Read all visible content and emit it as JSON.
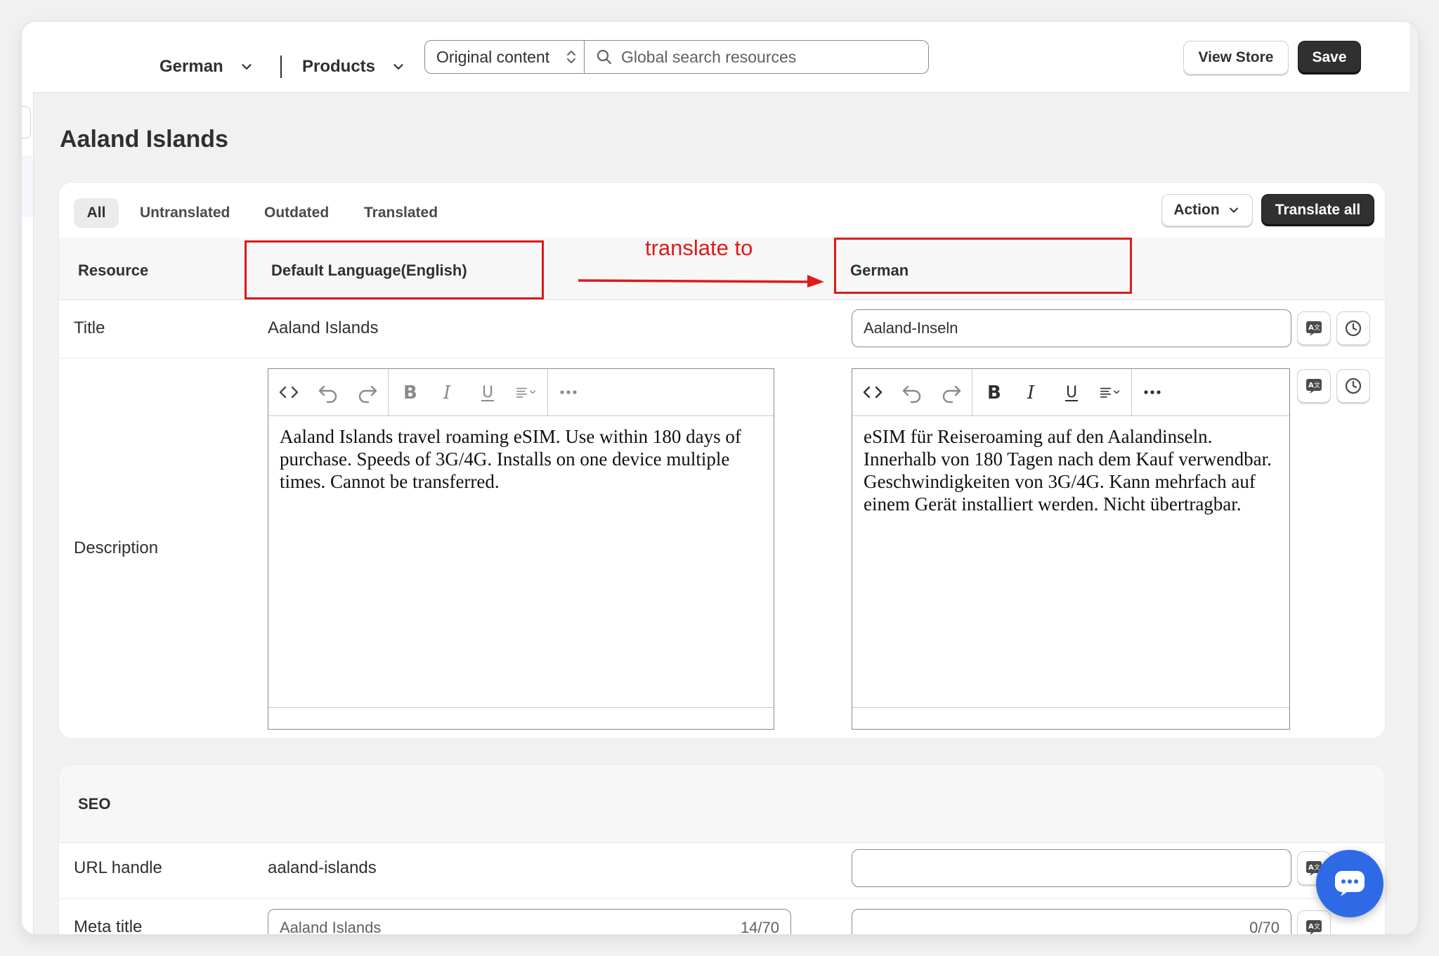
{
  "topbar": {
    "language": "German",
    "resource_type": "Products",
    "content_select": "Original content",
    "search_placeholder": "Global search resources",
    "view_store": "View Store",
    "save": "Save"
  },
  "page_title": "Aaland Islands",
  "tabs": [
    "All",
    "Untranslated",
    "Outdated",
    "Translated"
  ],
  "actions": {
    "action": "Action",
    "translate_all": "Translate all"
  },
  "columns": {
    "resource": "Resource",
    "default_language": "Default Language(English)",
    "target_language": "German"
  },
  "annotation": {
    "text": "translate to",
    "color": "#e01919"
  },
  "rows": {
    "title": {
      "label": "Title",
      "original": "Aaland Islands",
      "translated": "Aaland-Inseln"
    },
    "description": {
      "label": "Description",
      "original": "Aaland Islands travel roaming eSIM. Use within 180 days of purchase. Speeds of 3G/4G. Installs on one device multiple times. Cannot be transferred.",
      "translated": "eSIM für Reiseroaming auf den Aalandinseln. Innerhalb von 180 Tagen nach dem Kauf verwendbar. Geschwindigkeiten von 3G/4G. Kann mehrfach auf einem Gerät installiert werden. Nicht übertragbar."
    }
  },
  "seo": {
    "header": "SEO",
    "url_handle": {
      "label": "URL handle",
      "original": "aaland-islands",
      "translated": ""
    },
    "meta_title": {
      "label": "Meta title",
      "original": "Aaland Islands",
      "original_count": "14/70",
      "translated": "",
      "translated_count": "0/70"
    }
  },
  "icons": {
    "translate": "translate-icon",
    "history": "history-clock-icon",
    "chat": "chat-icon"
  },
  "colors": {
    "dark_button": "#303030",
    "accent_red": "#e01919",
    "chat_blue": "#2e6ae6"
  }
}
